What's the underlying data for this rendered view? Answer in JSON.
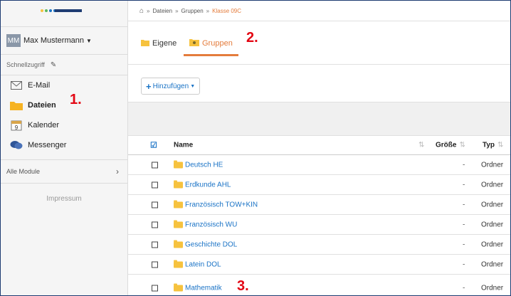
{
  "sidebar": {
    "user": {
      "initials": "MM",
      "name": "Max Mustermann"
    },
    "quick_access_label": "Schnellzugriff",
    "items": [
      {
        "label": "E-Mail",
        "icon": "mail-icon"
      },
      {
        "label": "Dateien",
        "icon": "folder-icon",
        "active": true
      },
      {
        "label": "Kalender",
        "icon": "calendar-icon",
        "day": "9"
      },
      {
        "label": "Messenger",
        "icon": "chat-bubbles-icon"
      }
    ],
    "modules_label": "Alle Module",
    "impressum": "Impressum"
  },
  "breadcrumb": {
    "items": [
      "Dateien",
      "Gruppen"
    ],
    "current": "Klasse 09C",
    "separator": "»"
  },
  "tabs": [
    {
      "label": "Eigene",
      "active": false
    },
    {
      "label": "Gruppen",
      "active": true
    }
  ],
  "toolbar": {
    "add_label": "Hinzufügen"
  },
  "table": {
    "headers": {
      "name": "Name",
      "size": "Größe",
      "type": "Typ"
    },
    "rows": [
      {
        "name": "Deutsch HE",
        "size": "-",
        "type": "Ordner"
      },
      {
        "name": "Erdkunde AHL",
        "size": "-",
        "type": "Ordner"
      },
      {
        "name": "Französisch TOW+KIN",
        "size": "-",
        "type": "Ordner"
      },
      {
        "name": "Französisch WU",
        "size": "-",
        "type": "Ordner"
      },
      {
        "name": "Geschichte DOL",
        "size": "-",
        "type": "Ordner"
      },
      {
        "name": "Latein DOL",
        "size": "-",
        "type": "Ordner"
      },
      {
        "name": "Mathematik",
        "size": "-",
        "type": "Ordner"
      }
    ]
  },
  "annotations": {
    "step1": "1.",
    "step2": "2.",
    "step3": "3."
  },
  "colors": {
    "accent": "#e47c3c",
    "link": "#1a73c6",
    "annotation": "#e30613",
    "frame": "#1e3c72"
  }
}
